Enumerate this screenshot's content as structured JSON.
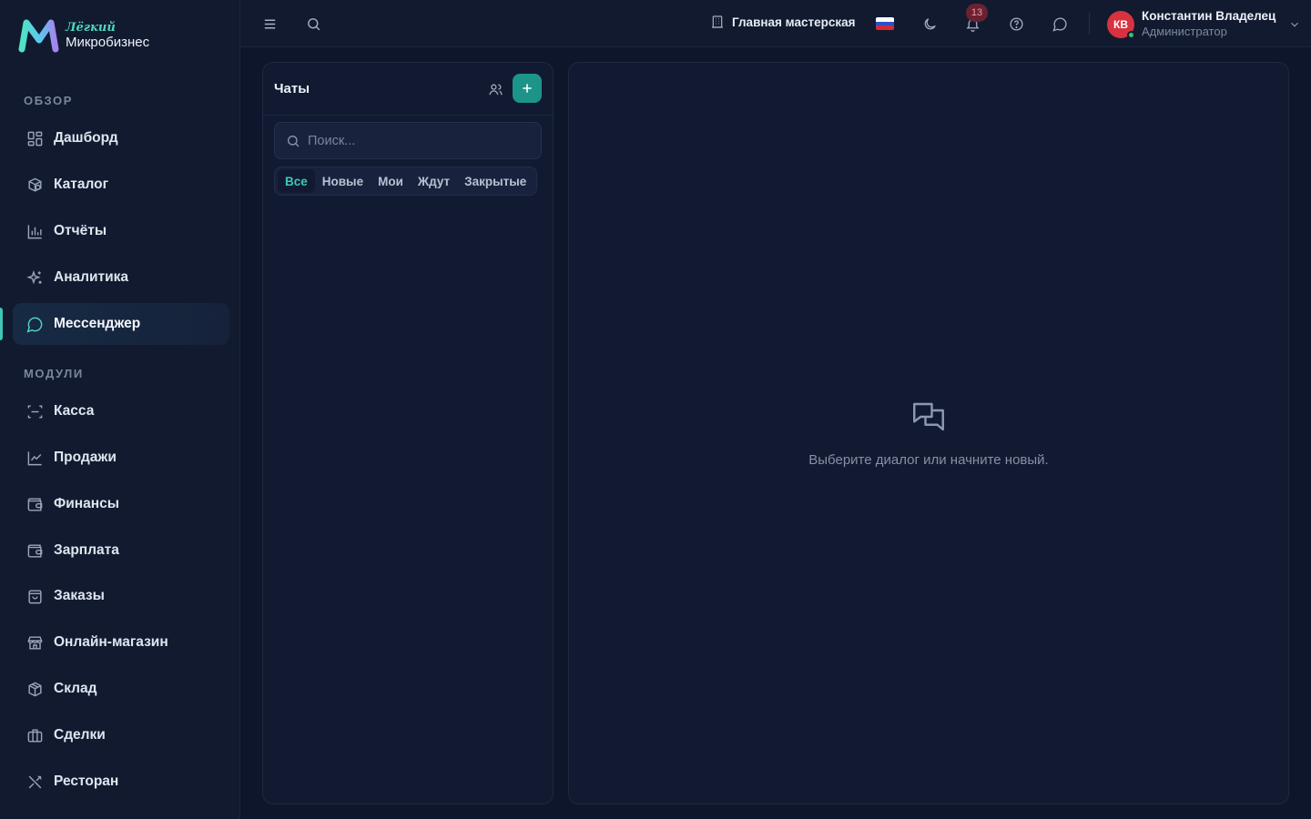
{
  "brand": {
    "tagline": "Лёгкий",
    "name": "Микробизнес"
  },
  "sidebar": {
    "sections": [
      {
        "label": "ОБЗОР"
      },
      {
        "label": "МОДУЛИ"
      }
    ],
    "items": [
      {
        "label": "Дашборд",
        "icon": "dashboard-icon"
      },
      {
        "label": "Каталог",
        "icon": "catalog-icon"
      },
      {
        "label": "Отчёты",
        "icon": "reports-icon"
      },
      {
        "label": "Аналитика",
        "icon": "sparkles-icon"
      },
      {
        "label": "Мессенджер",
        "icon": "message-icon",
        "active": true
      },
      {
        "label": "Касса",
        "icon": "scan-icon"
      },
      {
        "label": "Продажи",
        "icon": "line-chart-icon"
      },
      {
        "label": "Финансы",
        "icon": "wallet-icon"
      },
      {
        "label": "Зарплата",
        "icon": "wallet-icon"
      },
      {
        "label": "Заказы",
        "icon": "shopping-bag-icon"
      },
      {
        "label": "Онлайн-магазин",
        "icon": "store-icon"
      },
      {
        "label": "Склад",
        "icon": "package-icon"
      },
      {
        "label": "Сделки",
        "icon": "briefcase-icon"
      },
      {
        "label": "Ресторан",
        "icon": "utensils-icon"
      }
    ]
  },
  "topbar": {
    "workshop": "Главная мастерская",
    "language": "ru",
    "notifications_count": "13",
    "user": {
      "initials": "КВ",
      "name": "Константин Владелец",
      "role": "Администратор",
      "status": "online"
    }
  },
  "chats": {
    "title": "Чаты",
    "search_placeholder": "Поиск...",
    "filters": [
      {
        "label": "Все",
        "active": true
      },
      {
        "label": "Новые"
      },
      {
        "label": "Мои"
      },
      {
        "label": "Ждут"
      },
      {
        "label": "Закрытые"
      }
    ]
  },
  "conversation": {
    "empty_text": "Выберите диалог или начните новый."
  },
  "colors": {
    "accent": "#3ec7b5",
    "button": "#1d9488",
    "background": "#0e162c",
    "panel": "#111a31",
    "avatar": "#d8323f",
    "badge": "#6b2230"
  }
}
